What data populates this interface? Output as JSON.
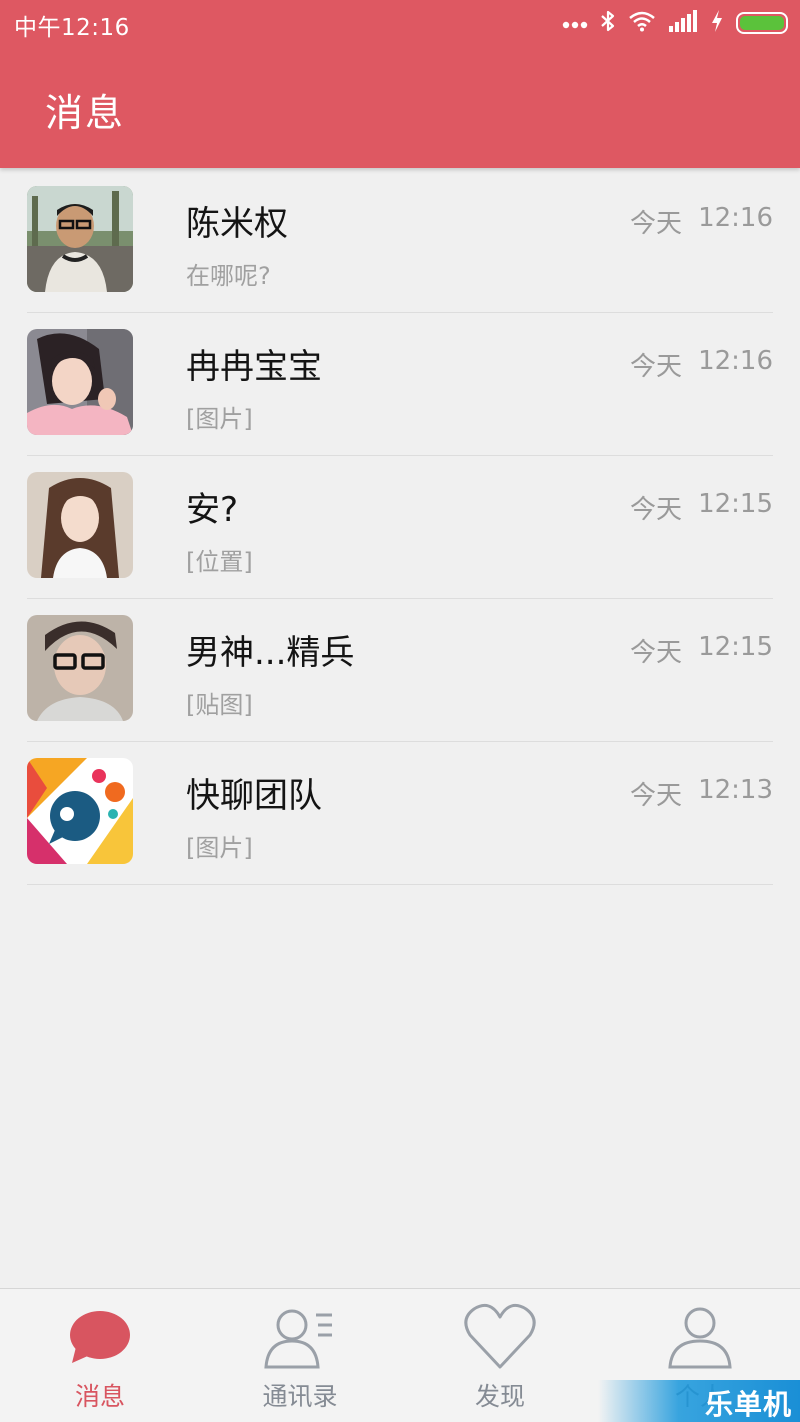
{
  "status_bar": {
    "time": "中午12:16",
    "icons": [
      "more-dots-icon",
      "bluetooth-icon",
      "wifi-icon",
      "signal-icon",
      "charging-icon",
      "battery-icon"
    ],
    "battery_color": "#5bc23b"
  },
  "app_bar": {
    "title": "消息",
    "color": "#de5862"
  },
  "conversations": [
    {
      "name": "陈米权",
      "preview": "在哪呢?",
      "day": "今天",
      "time": "12:16",
      "avatar": "man-with-glasses-photo"
    },
    {
      "name": "冉冉宝宝",
      "preview": "[图片]",
      "day": "今天",
      "time": "12:16",
      "avatar": "girl-pink-shirt-photo"
    },
    {
      "name": "安?",
      "preview": "[位置]",
      "day": "今天",
      "time": "12:15",
      "avatar": "girl-long-hair-photo"
    },
    {
      "name": "男神...精兵",
      "preview": "[贴图]",
      "day": "今天",
      "time": "12:15",
      "avatar": "boy-with-glasses-photo"
    },
    {
      "name": "快聊团队",
      "preview": "[图片]",
      "day": "今天",
      "time": "12:13",
      "avatar": "kuailiao-logo"
    }
  ],
  "tab_bar": {
    "tabs": [
      {
        "label": "消息",
        "icon": "chat-bubble-icon",
        "active": true
      },
      {
        "label": "通讯录",
        "icon": "contacts-icon",
        "active": false
      },
      {
        "label": "发现",
        "icon": "heart-icon",
        "active": false
      },
      {
        "label": "个人",
        "icon": "person-icon",
        "active": false
      }
    ],
    "active_color": "#d85560",
    "inactive_color": "#858b94"
  },
  "watermark": {
    "text": "乐单机"
  }
}
